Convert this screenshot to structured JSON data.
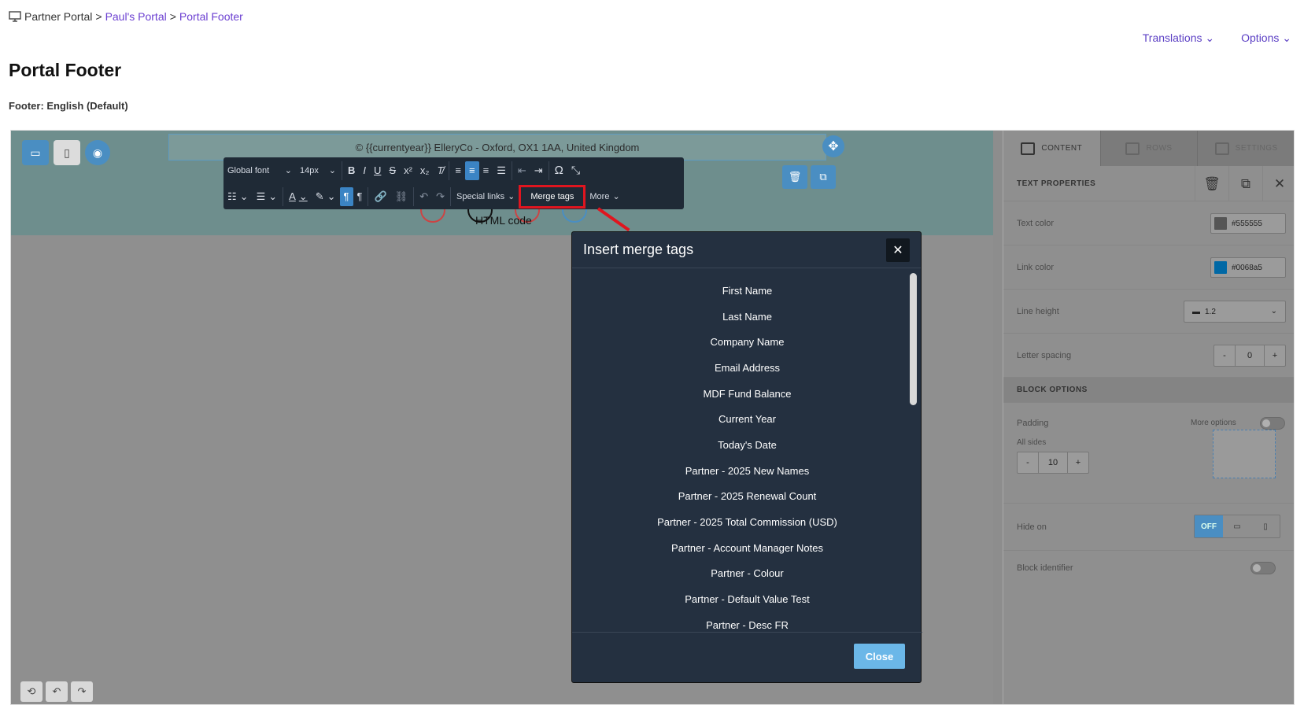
{
  "breadcrumb": {
    "root": "Partner Portal",
    "sep1": ">",
    "portal": "Paul's Portal",
    "sep2": ">",
    "current": "Portal Footer"
  },
  "top_actions": {
    "translations": "Translations",
    "options": "Options"
  },
  "page": {
    "title": "Portal Footer",
    "subtitle": "Footer: English (Default)"
  },
  "canvas": {
    "footer_text": "© {{currentyear}} ElleryCo - Oxford, OX1 1AA, United Kingdom",
    "html_code_label": "HTML code"
  },
  "toolbar": {
    "font": "Global font",
    "size": "14px",
    "special_links": "Special links",
    "merge_tags": "Merge tags",
    "more": "More"
  },
  "modal": {
    "title": "Insert merge tags",
    "close_label": "Close",
    "tags": [
      "First Name",
      "Last Name",
      "Company Name",
      "Email Address",
      "MDF Fund Balance",
      "Current Year",
      "Today's Date",
      "Partner - 2025 New Names",
      "Partner - 2025 Renewal Count",
      "Partner - 2025 Total Commission (USD)",
      "Partner - Account Manager Notes",
      "Partner - Colour",
      "Partner - Default Value Test",
      "Partner - Desc FR"
    ]
  },
  "panel": {
    "tabs": {
      "content": "CONTENT",
      "rows": "ROWS",
      "settings": "SETTINGS"
    },
    "text_properties": "TEXT PROPERTIES",
    "text_color_label": "Text color",
    "text_color": "#555555",
    "link_color_label": "Link color",
    "link_color": "#0068a5",
    "line_height_label": "Line height",
    "line_height": "1.2",
    "letter_spacing_label": "Letter spacing",
    "letter_spacing": "0",
    "block_options": "BLOCK OPTIONS",
    "padding_label": "Padding",
    "more_options": "More options",
    "all_sides": "All sides",
    "padding_value": "10",
    "hide_on_label": "Hide on",
    "hide_off": "OFF",
    "block_identifier": "Block identifier",
    "minus": "-",
    "plus": "+"
  }
}
